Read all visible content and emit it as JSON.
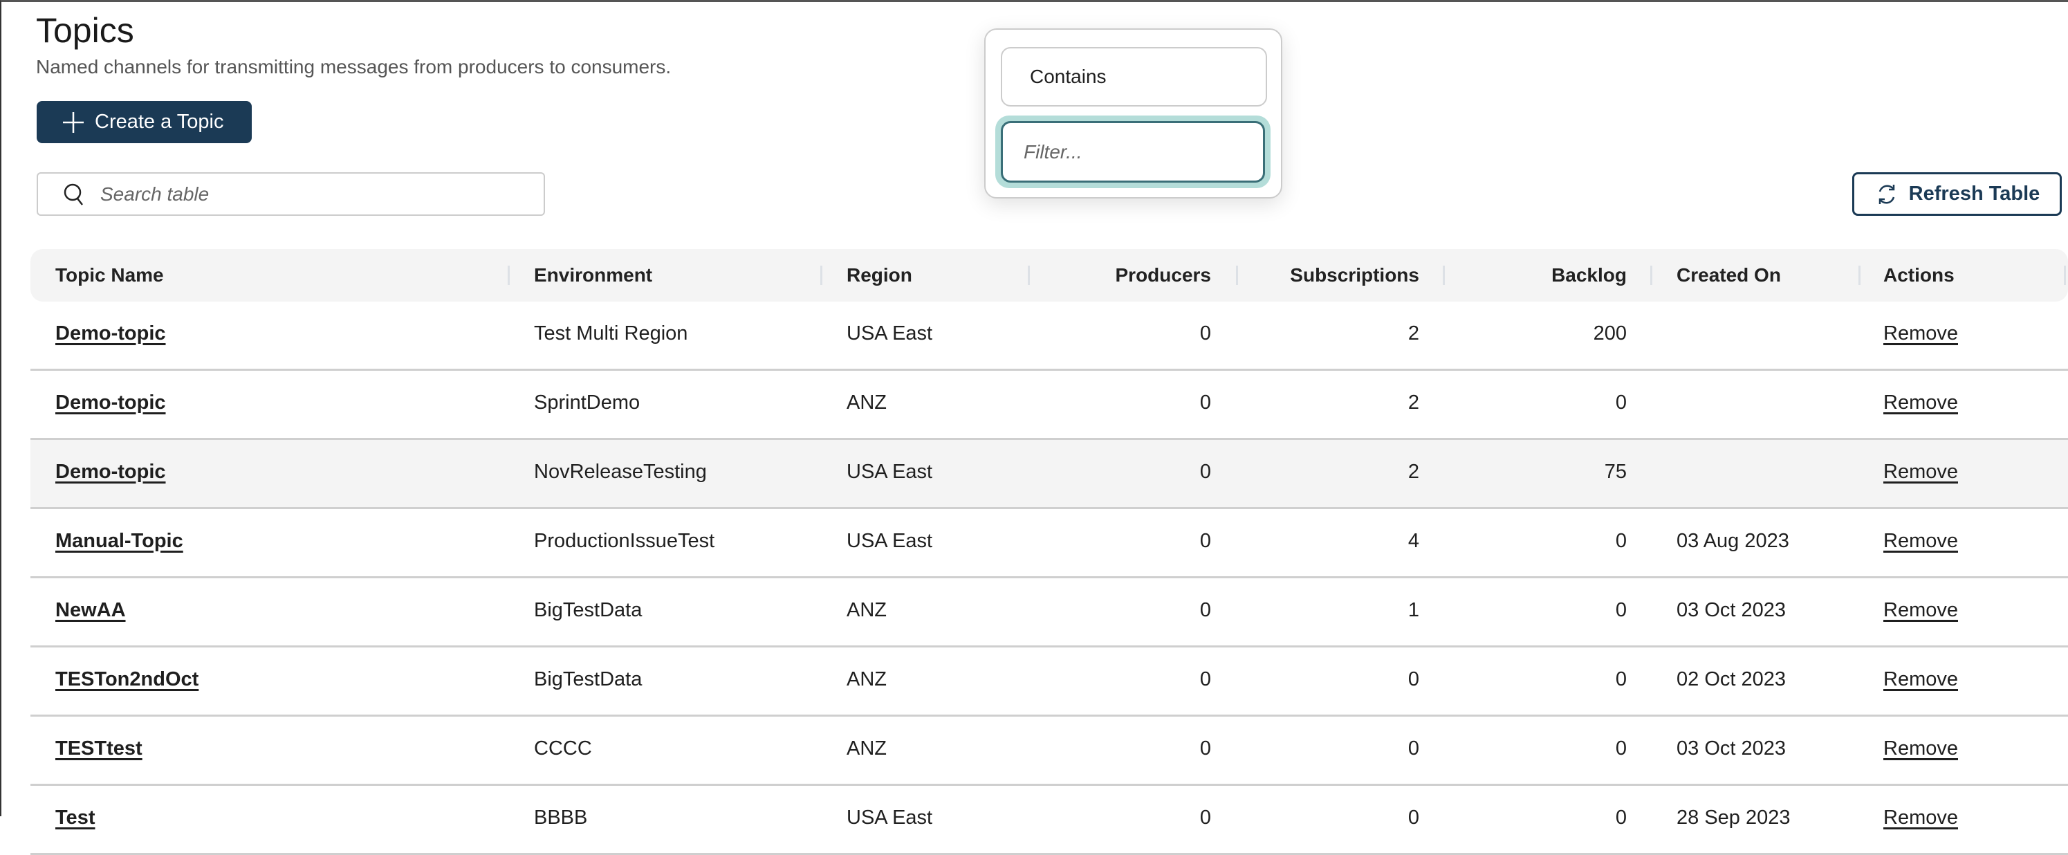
{
  "page": {
    "title": "Topics",
    "subtitle": "Named channels for transmitting messages from producers to consumers."
  },
  "toolbar": {
    "create_label": "Create a Topic",
    "search_placeholder": "Search table",
    "refresh_label": "Refresh Table"
  },
  "filter_popover": {
    "operator": "Contains",
    "placeholder": "Filter..."
  },
  "colors": {
    "primary": "#1b3a55",
    "link": "#2f7480",
    "focus_ring": "#b4ddd9"
  },
  "table": {
    "columns": [
      "Topic Name",
      "Environment",
      "Region",
      "Producers",
      "Subscriptions",
      "Backlog",
      "Created On",
      "Actions"
    ],
    "rows": [
      {
        "name": "Demo-topic",
        "env": "Test Multi Region",
        "region": "USA East",
        "producers": "0",
        "subs": "2",
        "backlog": "200",
        "created": "",
        "action": "Remove"
      },
      {
        "name": "Demo-topic",
        "env": "SprintDemo",
        "region": "ANZ",
        "producers": "0",
        "subs": "2",
        "backlog": "0",
        "created": "",
        "action": "Remove"
      },
      {
        "name": "Demo-topic",
        "env": "NovReleaseTesting",
        "region": "USA East",
        "producers": "0",
        "subs": "2",
        "backlog": "75",
        "created": "",
        "action": "Remove"
      },
      {
        "name": "Manual-Topic",
        "env": "ProductionIssueTest",
        "region": "USA East",
        "producers": "0",
        "subs": "4",
        "backlog": "0",
        "created": "03 Aug 2023",
        "action": "Remove"
      },
      {
        "name": "NewAA",
        "env": "BigTestData",
        "region": "ANZ",
        "producers": "0",
        "subs": "1",
        "backlog": "0",
        "created": "03 Oct 2023",
        "action": "Remove"
      },
      {
        "name": "TESTon2ndOct",
        "env": "BigTestData",
        "region": "ANZ",
        "producers": "0",
        "subs": "0",
        "backlog": "0",
        "created": "02 Oct 2023",
        "action": "Remove"
      },
      {
        "name": "TESTtest",
        "env": "CCCC",
        "region": "ANZ",
        "producers": "0",
        "subs": "0",
        "backlog": "0",
        "created": "03 Oct 2023",
        "action": "Remove"
      },
      {
        "name": "Test",
        "env": "BBBB",
        "region": "USA East",
        "producers": "0",
        "subs": "0",
        "backlog": "0",
        "created": "28 Sep 2023",
        "action": "Remove"
      }
    ]
  }
}
